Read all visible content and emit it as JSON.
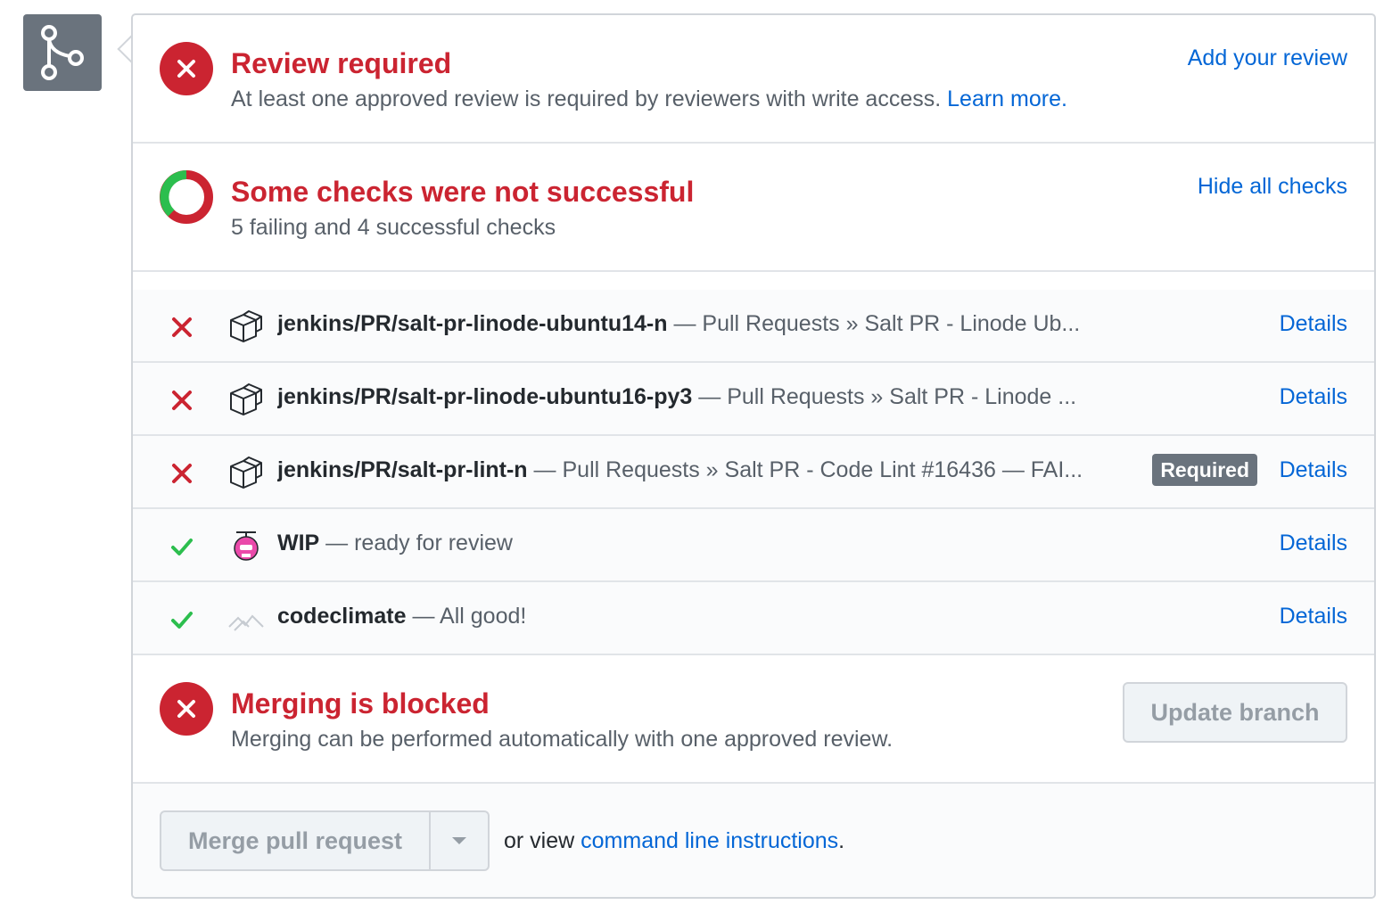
{
  "review": {
    "title": "Review required",
    "description": "At least one approved review is required by reviewers with write access.",
    "learn_more": "Learn more.",
    "action": "Add your review"
  },
  "checks_summary": {
    "title": "Some checks were not successful",
    "description": "5 failing and 4 successful checks",
    "action": "Hide all checks"
  },
  "checks": [
    {
      "status": "failure",
      "icon": "jenkins-box-icon",
      "name": "jenkins/PR/salt-pr-linode-ubuntu14-n",
      "desc": " — Pull Requests » Salt PR - Linode Ub...",
      "required": false,
      "details": "Details"
    },
    {
      "status": "failure",
      "icon": "jenkins-box-icon",
      "name": "jenkins/PR/salt-pr-linode-ubuntu16-py3",
      "desc": " — Pull Requests » Salt PR - Linode ...",
      "required": false,
      "details": "Details"
    },
    {
      "status": "failure",
      "icon": "jenkins-box-icon",
      "name": "jenkins/PR/salt-pr-lint-n",
      "desc": " — Pull Requests » Salt PR - Code Lint #16436 — FAI...",
      "required": true,
      "required_label": "Required",
      "details": "Details"
    },
    {
      "status": "success",
      "icon": "wip-bot-icon",
      "name": "WIP",
      "desc": " — ready for review",
      "required": false,
      "details": "Details"
    },
    {
      "status": "success",
      "icon": "codeclimate-icon",
      "name": "codeclimate",
      "desc": " — All good!",
      "required": false,
      "details": "Details"
    }
  ],
  "merge_status": {
    "title": "Merging is blocked",
    "description": "Merging can be performed automatically with one approved review.",
    "update_button": "Update branch"
  },
  "merge_footer": {
    "merge_button": "Merge pull request",
    "prefix": "or view ",
    "cli_link": "command line instructions",
    "suffix": "."
  },
  "colors": {
    "failure": "#cb2431",
    "success": "#2cbe4e",
    "link": "#0366d6",
    "muted": "#586069"
  }
}
